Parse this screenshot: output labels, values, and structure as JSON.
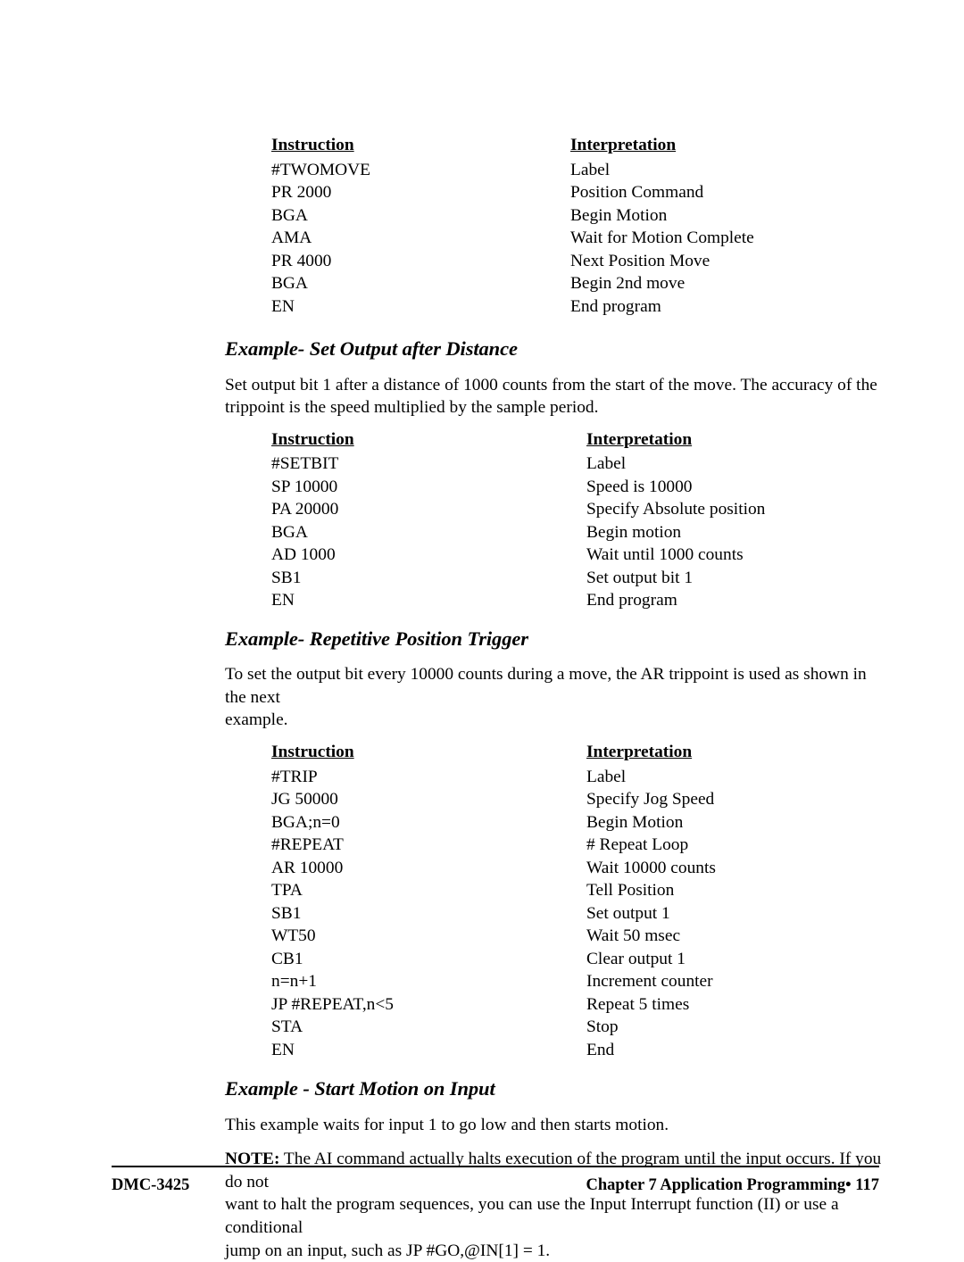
{
  "document": {
    "headers": {
      "instruction": "Instruction",
      "interpretation": "Interpretation"
    }
  },
  "table_twomove": {
    "rows": [
      {
        "instruction": "#TWOMOVE",
        "interpretation": "Label"
      },
      {
        "instruction": "PR 2000",
        "interpretation": "Position Command"
      },
      {
        "instruction": "BGA",
        "interpretation": "Begin Motion"
      },
      {
        "instruction": "AMA",
        "interpretation": "Wait for Motion Complete"
      },
      {
        "instruction": "PR 4000",
        "interpretation": "Next Position Move"
      },
      {
        "instruction": "BGA",
        "interpretation": "Begin 2nd move"
      },
      {
        "instruction": "EN",
        "interpretation": "End program"
      }
    ]
  },
  "section_setbit": {
    "heading": "Example- Set Output after Distance",
    "paragraph_line1": "Set output bit 1 after a distance of 1000 counts from the start of the move.  The accuracy of the",
    "paragraph_line2": "trippoint is the speed multiplied by the sample period.",
    "rows": [
      {
        "instruction": "#SETBIT",
        "interpretation": "Label"
      },
      {
        "instruction": "SP 10000",
        "interpretation": "Speed is 10000"
      },
      {
        "instruction": "PA 20000",
        "interpretation": "Specify Absolute position"
      },
      {
        "instruction": "BGA",
        "interpretation": "Begin motion"
      },
      {
        "instruction": "AD 1000",
        "interpretation": "Wait until 1000 counts"
      },
      {
        "instruction": "SB1",
        "interpretation": "Set output bit 1"
      },
      {
        "instruction": "EN",
        "interpretation": "End program"
      }
    ]
  },
  "section_trip": {
    "heading": "Example- Repetitive Position Trigger",
    "paragraph_line1": "To set the output bit every 10000 counts during a move, the AR trippoint is used as shown in the next",
    "paragraph_line2": "example.",
    "rows": [
      {
        "instruction": "#TRIP",
        "interpretation": "Label"
      },
      {
        "instruction": "JG 50000",
        "interpretation": "Specify Jog Speed"
      },
      {
        "instruction": "BGA;n=0",
        "interpretation": "Begin Motion"
      },
      {
        "instruction": "#REPEAT",
        "interpretation": "# Repeat Loop"
      },
      {
        "instruction": "AR 10000",
        "interpretation": "Wait 10000 counts"
      },
      {
        "instruction": "TPA",
        "interpretation": "Tell Position"
      },
      {
        "instruction": "SB1",
        "interpretation": "Set output 1"
      },
      {
        "instruction": "WT50",
        "interpretation": "Wait 50 msec"
      },
      {
        "instruction": "CB1",
        "interpretation": "Clear output 1"
      },
      {
        "instruction": "n=n+1",
        "interpretation": "Increment counter"
      },
      {
        "instruction": "JP #REPEAT,n<5",
        "interpretation": "Repeat 5 times"
      },
      {
        "instruction": "STA",
        "interpretation": "Stop"
      },
      {
        "instruction": "EN",
        "interpretation": "End"
      }
    ]
  },
  "section_input": {
    "heading": "Example - Start Motion on Input",
    "paragraph": "This example waits for input 1 to go low and then starts motion.",
    "note_label": "NOTE:",
    "note_line1": "The AI command actually halts execution of the program until the input occurs.  If you do not",
    "note_line2": "want to halt the program sequences, you can use the Input Interrupt function (II) or use a conditional",
    "note_line3": "jump on an input, such as JP #GO,@IN[1] = 1."
  },
  "footer": {
    "left": "DMC-3425",
    "right": "Chapter 7 Application Programming•  117"
  }
}
